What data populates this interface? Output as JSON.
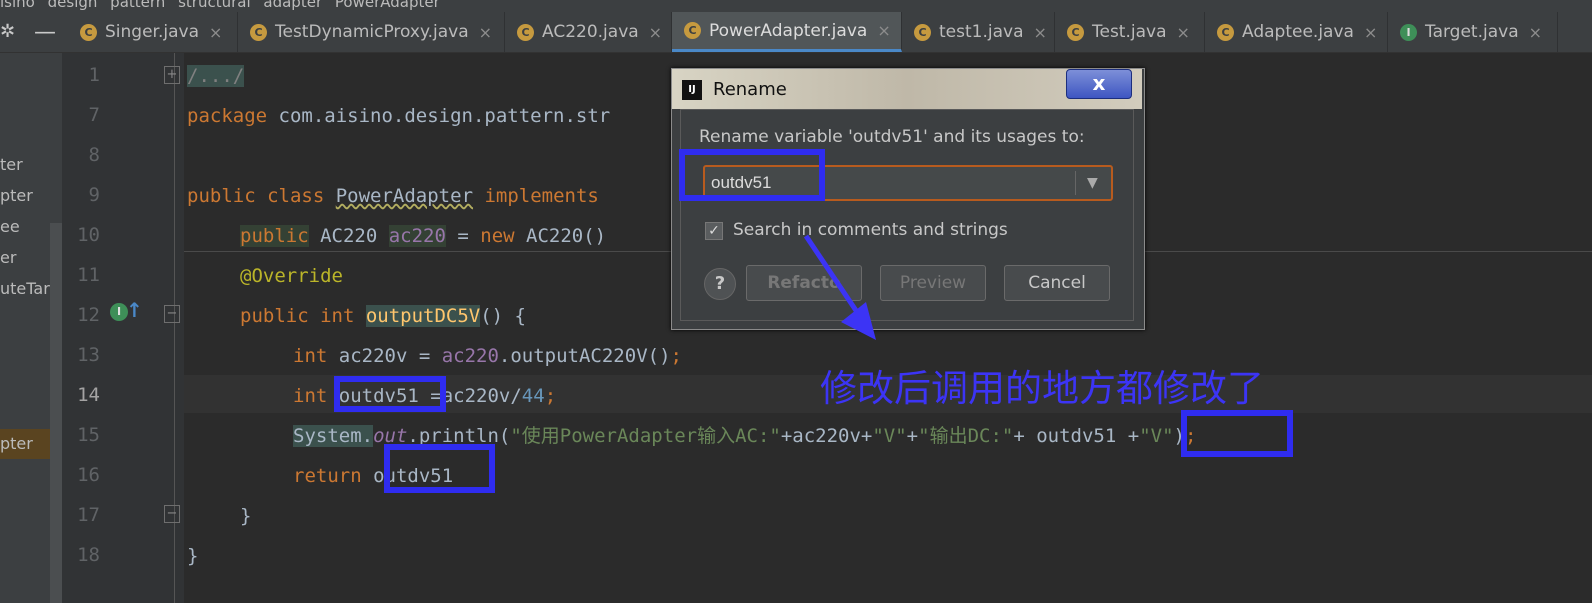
{
  "breadcrumb": [
    "isino",
    "design",
    "pattern",
    "structural",
    "adapter",
    "PowerAdapter"
  ],
  "tabs": [
    {
      "label": "Singer.java",
      "icon": "C",
      "active": false
    },
    {
      "label": "TestDynamicProxy.java",
      "icon": "C",
      "active": false
    },
    {
      "label": "AC220.java",
      "icon": "C",
      "active": false
    },
    {
      "label": "PowerAdapter.java",
      "icon": "C",
      "active": true
    },
    {
      "label": "test1.java",
      "icon": "C",
      "active": false
    },
    {
      "label": "Test.java",
      "icon": "C",
      "active": false
    },
    {
      "label": "Adaptee.java",
      "icon": "C",
      "active": false
    },
    {
      "label": "Target.java",
      "icon": "I",
      "active": false
    }
  ],
  "tab_close_glyph": "×",
  "project_panel": [
    "ter",
    "pter",
    "ee",
    "er",
    "uteTarge",
    "pter"
  ],
  "line_numbers": [
    "1",
    "7",
    "8",
    "9",
    "10",
    "11",
    "12",
    "13",
    "14",
    "15",
    "16",
    "17",
    "18"
  ],
  "code": {
    "l1": "/.../",
    "l7_kw": "package",
    "l7_rest": " com.aisino.design.pattern.str",
    "l9_kw1": "public class",
    "l9_name": "PowerAdapter",
    "l9_kw2": "implements",
    "l10_kw1": "public",
    "l10_type": " AC220 ",
    "l10_field": "ac220",
    "l10_eq": " = ",
    "l10_kw2": "new",
    "l10_rest": " AC220()",
    "l11": "@Override",
    "l12_kw": "public int",
    "l12_method": "outputDC5V",
    "l12_rest": "() {",
    "l13_kw": "int",
    "l13_var": " ac220v = ",
    "l13_field": "ac220",
    "l13_rest": ".outputAC220V()",
    "l13_semi": ";",
    "l14_kw": "int",
    "l14_var": " outdv51",
    "l14_rest": " =ac220v/",
    "l14_num": "44",
    "l14_semi": ";",
    "l15_a": "System.",
    "l15_out": "out",
    "l15_b": ".println(",
    "l15_str1": "\"使用PowerAdapter输入AC:\"",
    "l15_c": "+ac220v+",
    "l15_str2": "\"V\"",
    "l15_d": "+",
    "l15_str3": "\"输出DC:\"",
    "l15_e": "+ ",
    "l15_var": "outdv51",
    "l15_f": " +",
    "l15_str4": "\"V\"",
    "l15_g": ")",
    "l15_semi": ";",
    "l16_kw": "return",
    "l16_var": " outdv51",
    "l17": "}",
    "l18": "}"
  },
  "gutter_badge": "I",
  "gutter_arrow": "↑",
  "dialog": {
    "title": "Rename",
    "logo": "IJ",
    "close": "x",
    "prompt": "Rename variable 'outdv51' and its usages to:",
    "input_value": "outdv51",
    "checkbox_label": "Search in comments and strings",
    "checkbox_checked": true,
    "help": "?",
    "buttons": {
      "refactor": "Refacto",
      "preview": "Preview",
      "cancel": "Cancel"
    }
  },
  "annotation": "修改后调用的地方都修改了",
  "colors": {
    "highlight_box": "#2f2cf0",
    "annotation": "#3c34f5",
    "editor_bg": "#2b2b2b"
  }
}
